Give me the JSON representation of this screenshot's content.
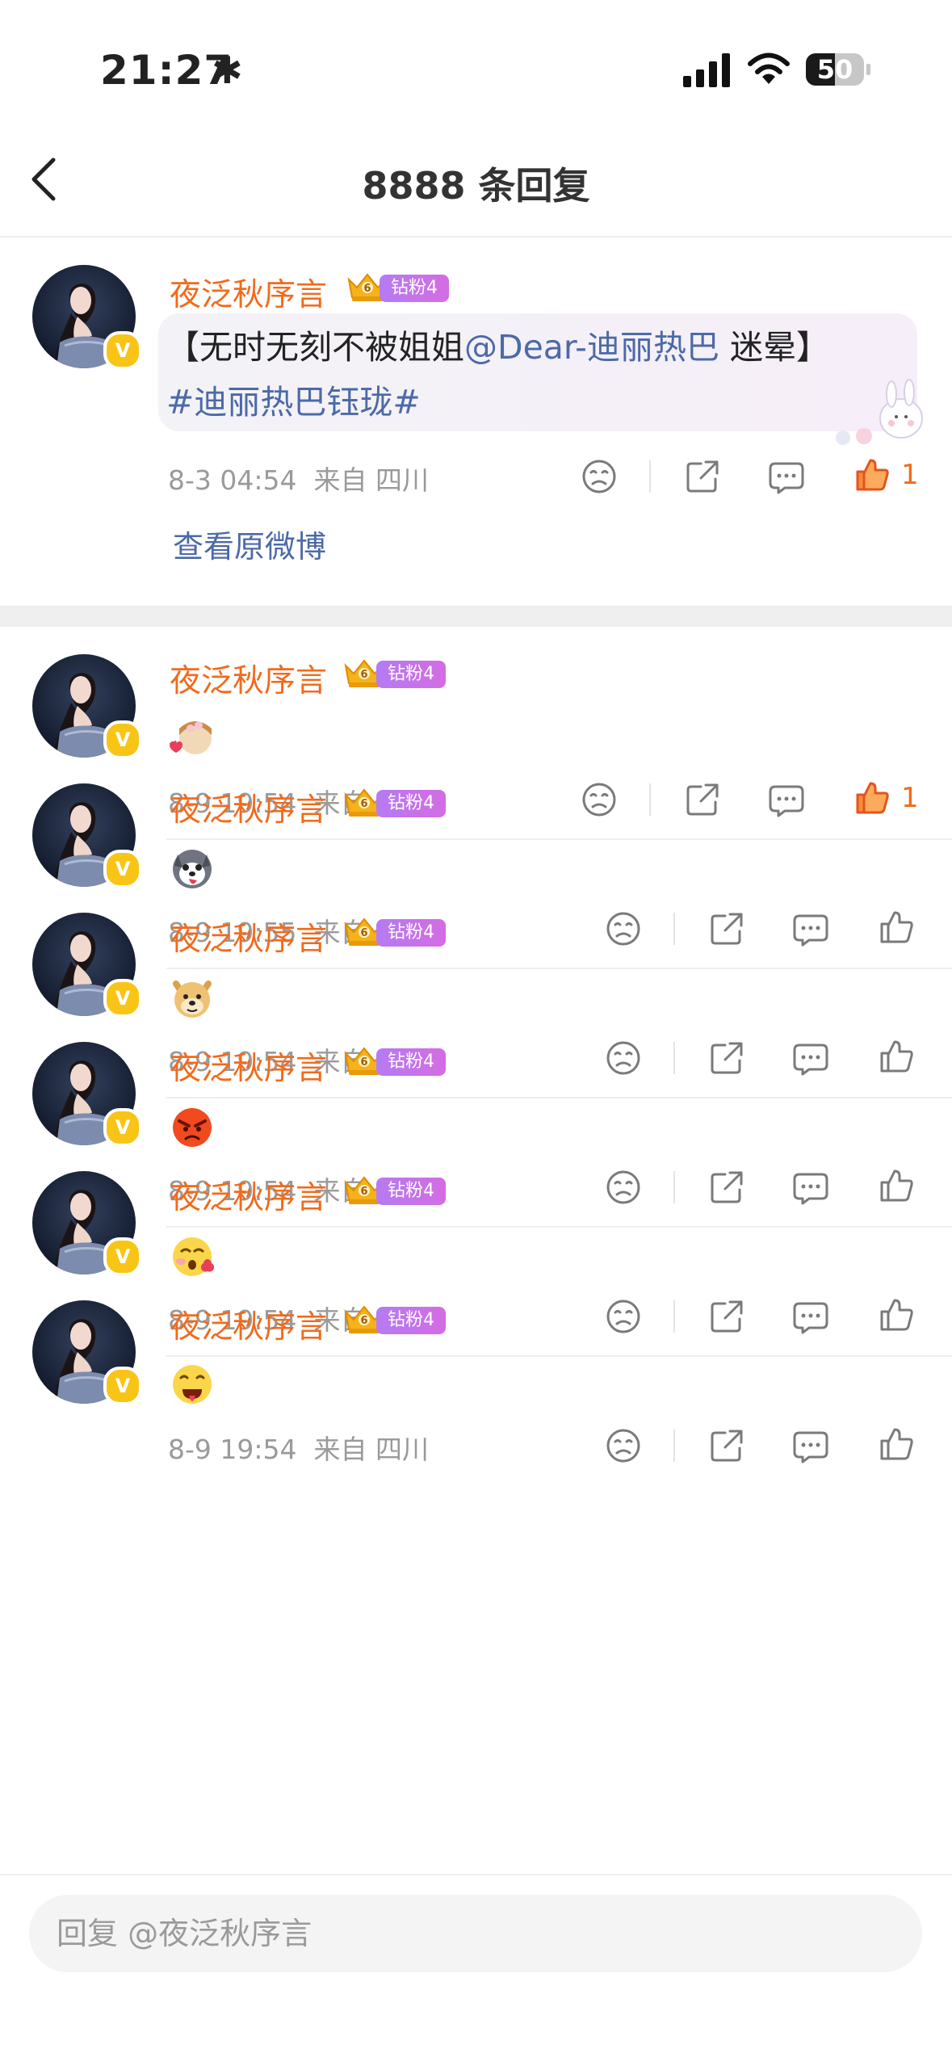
{
  "status": {
    "time": "21:27",
    "time_symbol": "✱",
    "battery": "50",
    "battery_level": 0.5
  },
  "nav": {
    "title": "8888 条回复"
  },
  "badge_text": "钻粉4",
  "post": {
    "username": "夜泛秋序言",
    "content_pre": "【无时无刻不被姐姐",
    "mention": "@Dear-迪丽热巴",
    "content_post": " 迷晕】",
    "hashtag": "#迪丽热巴钰珑#",
    "time": "8-3 04:54",
    "source": "来自 四川",
    "like_count": "1",
    "view_original": "查看原微博"
  },
  "replies": [
    {
      "username": "夜泛秋序言",
      "emoji": "shy-love-emoji",
      "time": "8-9 19:54",
      "source": "来自 四川",
      "like_count": "1",
      "liked": true
    },
    {
      "username": "夜泛秋序言",
      "emoji": "husky-emoji",
      "time": "8-9 19:55",
      "source": "来自 四川",
      "like_count": "",
      "liked": false
    },
    {
      "username": "夜泛秋序言",
      "emoji": "doge-emoji",
      "time": "8-9 19:54",
      "source": "来自 四川",
      "like_count": "",
      "liked": false
    },
    {
      "username": "夜泛秋序言",
      "emoji": "angry-emoji",
      "time": "8-9 19:54",
      "source": "来自 四川",
      "like_count": "",
      "liked": false
    },
    {
      "username": "夜泛秋序言",
      "emoji": "adoring-emoji",
      "time": "8-9 19:54",
      "source": "来自 四川",
      "like_count": "",
      "liked": false
    },
    {
      "username": "夜泛秋序言",
      "emoji": "drool-emoji",
      "time": "8-9 19:54",
      "source": "来自 四川",
      "like_count": "",
      "liked": false
    }
  ],
  "reply_box": {
    "placeholder": "回复 @夜泛秋序言"
  },
  "colors": {
    "username": "#f26a1b",
    "link": "#4c6aa7",
    "badge": "#c777ea",
    "vip": "#f8c517"
  }
}
